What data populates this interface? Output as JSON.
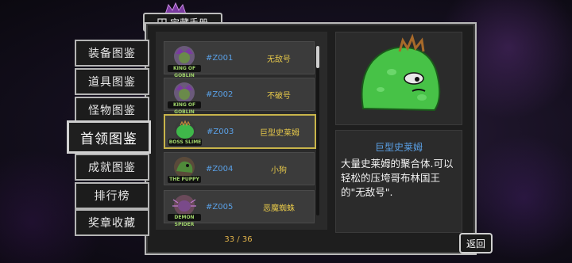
{
  "header": {
    "title": "宝藏手册",
    "book_icon": "book-icon",
    "crown_icon": "crown-icon"
  },
  "tabs": [
    {
      "label": "装备图鉴",
      "active": false
    },
    {
      "label": "道具图鉴",
      "active": false
    },
    {
      "label": "怪物图鉴",
      "active": false
    },
    {
      "label": "首领图鉴",
      "active": true
    },
    {
      "label": "成就图鉴",
      "active": false
    },
    {
      "label": "排行榜",
      "active": false
    },
    {
      "label": "奖章收藏",
      "active": false
    }
  ],
  "list": {
    "entries": [
      {
        "code": "#Z001",
        "name": "无敌号",
        "badge": "KING OF GOBLIN",
        "color": "#6a8a4a",
        "selected": false
      },
      {
        "code": "#Z002",
        "name": "不破号",
        "badge": "KING OF GOBLIN",
        "color": "#6a8a4a",
        "selected": false
      },
      {
        "code": "#Z003",
        "name": "巨型史莱姆",
        "badge": "BOSS SLIME",
        "color": "#3fb84a",
        "selected": true
      },
      {
        "code": "#Z004",
        "name": "小狗",
        "badge": "THE PUPPY",
        "color": "#4f8a3a",
        "selected": false
      },
      {
        "code": "#Z005",
        "name": "恶魔蜘蛛",
        "badge": "DEMON SPIDER",
        "color": "#7a4a8a",
        "selected": false
      }
    ],
    "page": "33 / 36"
  },
  "detail": {
    "name": "巨型史莱姆",
    "description": "大量史莱姆的聚合体.可以轻松的压垮哥布林国王的\"无敌号\".",
    "slime_color": "#47c247"
  },
  "back_button": {
    "label": "返回"
  }
}
